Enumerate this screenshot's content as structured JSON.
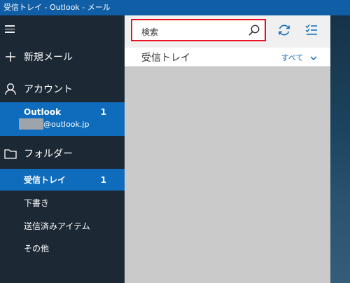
{
  "window": {
    "title": "受信トレイ - Outlook - メール"
  },
  "sidebar": {
    "new_mail": "新規メール",
    "account_header": "アカウント",
    "account": {
      "name": "Outlook",
      "count": "1",
      "email": "@outlook.jp"
    },
    "folders_header": "フォルダー",
    "folders": [
      {
        "label": "受信トレイ",
        "count": "1"
      },
      {
        "label": "下書き"
      },
      {
        "label": "送信済みアイテム"
      },
      {
        "label": "その他"
      }
    ]
  },
  "toolbar": {
    "search_placeholder": "検索",
    "icons": [
      "search-icon",
      "sync-icon",
      "selection-mode-icon"
    ]
  },
  "list": {
    "title": "受信トレイ",
    "filter_label": "すべて"
  },
  "colors": {
    "accent": "#0f6cbd",
    "titlebar": "#0f5ea6",
    "highlight_border": "#e81123"
  }
}
